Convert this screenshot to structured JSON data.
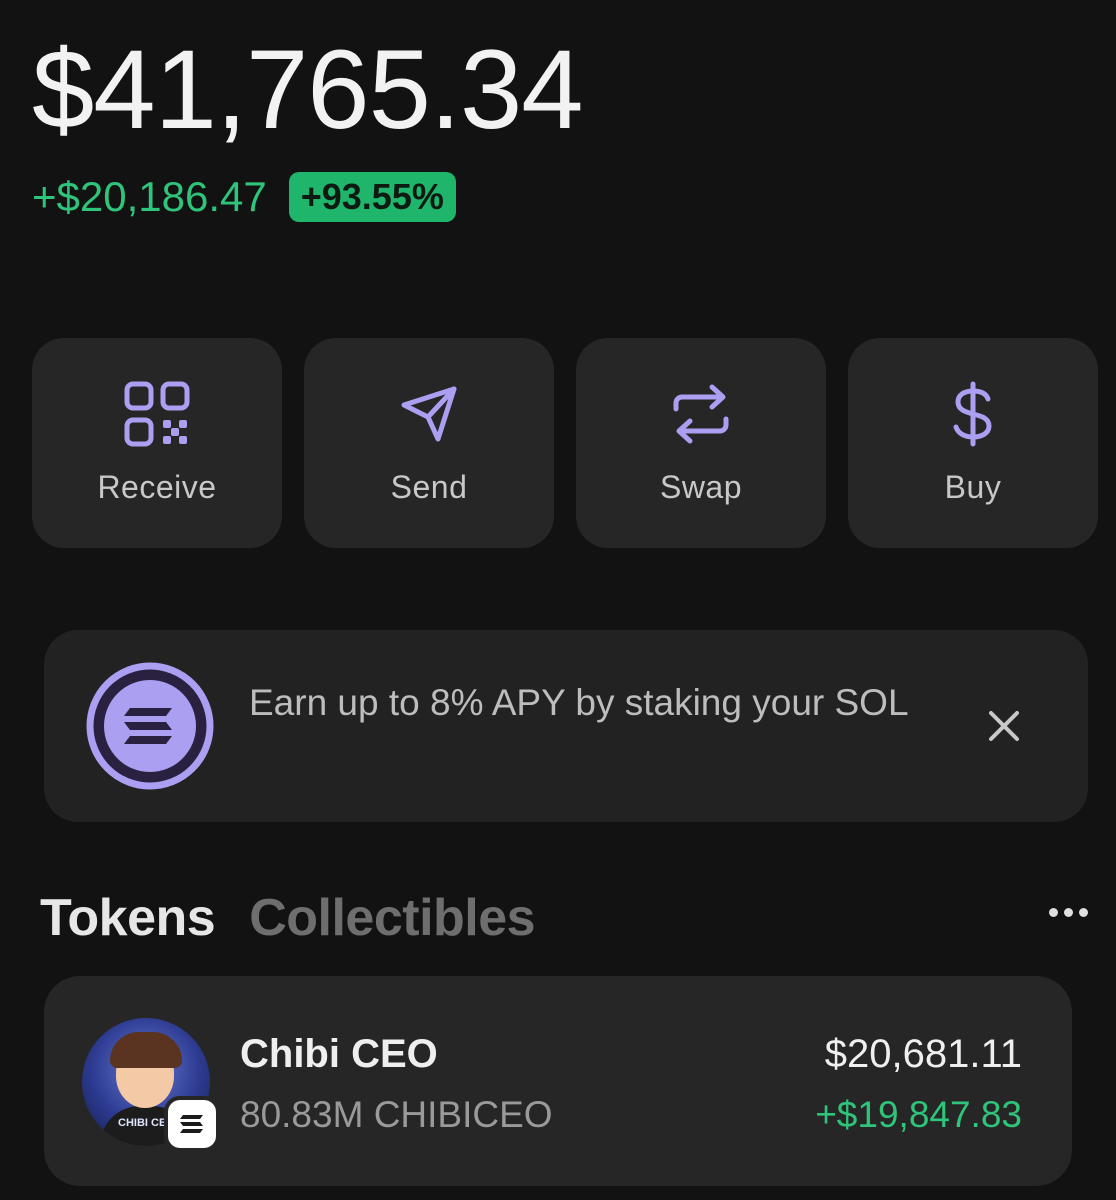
{
  "balance": "$41,765.34",
  "change": {
    "amount": "+$20,186.47",
    "percent": "+93.55%"
  },
  "actions": [
    {
      "label": "Receive",
      "icon": "qr-code-icon"
    },
    {
      "label": "Send",
      "icon": "send-icon"
    },
    {
      "label": "Swap",
      "icon": "swap-icon"
    },
    {
      "label": "Buy",
      "icon": "dollar-icon"
    }
  ],
  "promo": {
    "text": "Earn up to 8% APY by staking your SOL",
    "icon": "solana-icon",
    "close_icon": "close-icon"
  },
  "tabs": {
    "active": "Tokens",
    "inactive": "Collectibles"
  },
  "tokens": [
    {
      "name": "Chibi CEO",
      "amount": "80.83M CHIBICEO",
      "value": "$20,681.11",
      "change": "+$19,847.83",
      "avatar_text": "CHIBI CEO"
    }
  ],
  "colors": {
    "accent": "#ab9ff2",
    "positive": "#2ec47a",
    "card": "#262626",
    "background": "#121212"
  }
}
